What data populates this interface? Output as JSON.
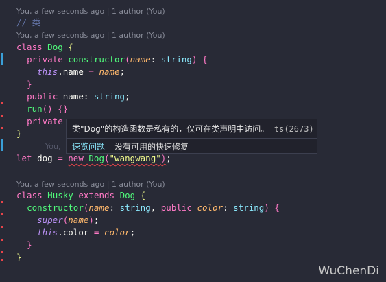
{
  "lens": {
    "line1": "You, a few seconds ago | 1 author (You)",
    "line2": "You, a few seconds ago | 1 author (You)",
    "line3": "You, a few seconds ago | 1 author (You)",
    "ghost": "You,"
  },
  "code": {
    "comment": "// 类",
    "t_class": "class",
    "t_dog": "Dog",
    "t_brace_open": " {",
    "t_private": "private",
    "t_constructor": "constructor",
    "t_name": "name",
    "t_string": "string",
    "t_this": "this",
    "t_public": "public",
    "t_run": "run",
    "t_let": "let",
    "t_dogvar": "dog",
    "t_new": "new",
    "t_wangwang": "\"wangwang\"",
    "t_husky": "Husky",
    "t_extends": "extends",
    "t_color": "color",
    "t_super": "super"
  },
  "hover": {
    "message": "类\"Dog\"的构造函数是私有的，仅可在类声明中访问。",
    "code": "ts(2673)",
    "peek": "速览问题",
    "no_fix": "没有可用的快速修复"
  },
  "watermark": "WuChenDi"
}
